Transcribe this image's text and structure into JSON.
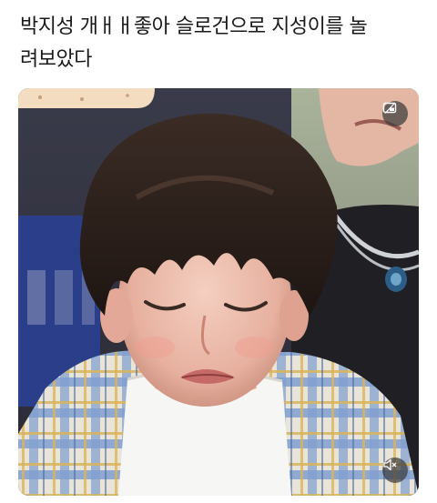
{
  "post": {
    "text": "박지성 개ㅐㅐ좋아 슬로건으로 지성이를 놀\n려보았다"
  },
  "media": {
    "type": "video",
    "controls": {
      "top_button_icon": "picture-in-picture-icon",
      "mute_button_icon": "muted-speaker-icon"
    }
  }
}
